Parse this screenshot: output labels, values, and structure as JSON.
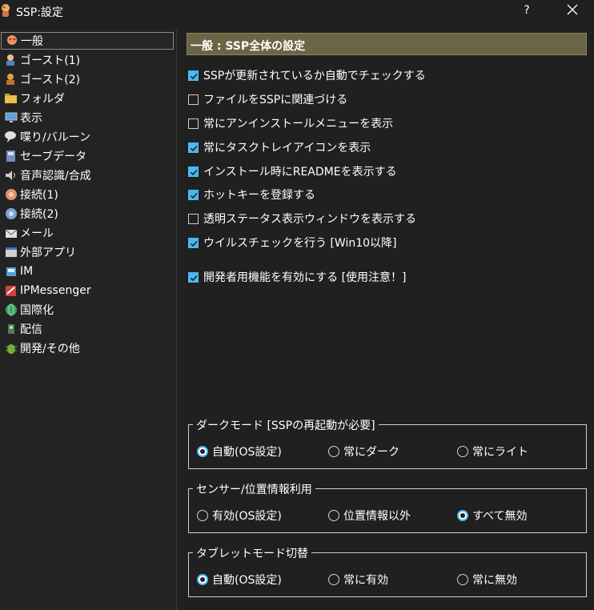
{
  "window": {
    "title": "SSP:設定",
    "help_label": "?"
  },
  "sidebar": {
    "items": [
      {
        "label": "一般"
      },
      {
        "label": "ゴースト(1)"
      },
      {
        "label": "ゴースト(2)"
      },
      {
        "label": "フォルダ"
      },
      {
        "label": "表示"
      },
      {
        "label": "喋り/バルーン"
      },
      {
        "label": "セーブデータ"
      },
      {
        "label": "音声認識/合成"
      },
      {
        "label": "接続(1)"
      },
      {
        "label": "接続(2)"
      },
      {
        "label": "メール"
      },
      {
        "label": "外部アプリ"
      },
      {
        "label": "IM"
      },
      {
        "label": "IPMessenger"
      },
      {
        "label": "国際化"
      },
      {
        "label": "配信"
      },
      {
        "label": "開発/その他"
      }
    ]
  },
  "main": {
    "header": "一般 : SSP全体の設定",
    "options": [
      {
        "label": "SSPが更新されているか自動でチェックする",
        "checked": true
      },
      {
        "label": "ファイルをSSPに関連づける",
        "checked": false
      },
      {
        "label": "常にアンインストールメニューを表示",
        "checked": false
      },
      {
        "label": "常にタスクトレイアイコンを表示",
        "checked": true
      },
      {
        "label": "インストール時にREADMEを表示する",
        "checked": true
      },
      {
        "label": "ホットキーを登録する",
        "checked": true
      },
      {
        "label": "透明ステータス表示ウィンドウを表示する",
        "checked": false
      },
      {
        "label": "ウイルスチェックを行う [Win10以降]",
        "checked": true
      },
      {
        "label": "開発者用機能を有効にする [使用注意！]",
        "checked": true
      }
    ],
    "groups": [
      {
        "title": "ダークモード [SSPの再起動が必要]",
        "options": [
          "自動(OS設定)",
          "常にダーク",
          "常にライト"
        ],
        "selected": 0
      },
      {
        "title": "センサー/位置情報利用",
        "options": [
          "有効(OS設定)",
          "位置情報以外",
          "すべて無効"
        ],
        "selected": 2
      },
      {
        "title": "タブレットモード切替",
        "options": [
          "自動(OS設定)",
          "常に有効",
          "常に無効"
        ],
        "selected": 0
      }
    ]
  },
  "colors": {
    "accent": "#4cb8f0",
    "header_bg": "#6b6545",
    "background": "#202020"
  }
}
